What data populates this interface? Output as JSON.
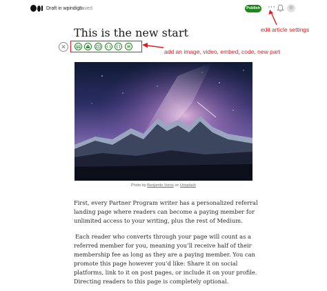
{
  "header": {
    "draft_label": "Draft in wpindigo",
    "saved_label": "Saved",
    "publish_label": "Publish",
    "more_label": "···",
    "icons": {
      "logo": "medium-logo-icon",
      "more": "more-options-icon",
      "bell": "notifications-bell-icon",
      "avatar": "user-avatar"
    },
    "accent_color": "#1a8917"
  },
  "annotations": {
    "settings": "edit article settings",
    "toolbar": "add an image, video, embed, code, new part",
    "color": "#e01b1b"
  },
  "article": {
    "title": "This is the new start",
    "toolbar_icons": [
      "close-icon",
      "image-icon",
      "unsplash-icon",
      "video-icon",
      "embed-icon",
      "code-icon",
      "new-part-icon"
    ],
    "caption": {
      "prefix": "Photo by ",
      "author": "Benjamin Voros",
      "middle": " on ",
      "source": "Unsplash"
    },
    "paragraphs": [
      "First, every Partner Program writer has a personalized referral landing page where readers can become a paying member for unlimited access to your writing, plus the rest of Medium.",
      "Each reader who converts through your page will count as a referred member for you, meaning you’ll receive half of their membership fee as long as they are a paying member. You can promote this page however you’d like: Share it on social platforms, link to it on post pages, or include it on your profile. Directing readers to this page is completely optional."
    ]
  }
}
